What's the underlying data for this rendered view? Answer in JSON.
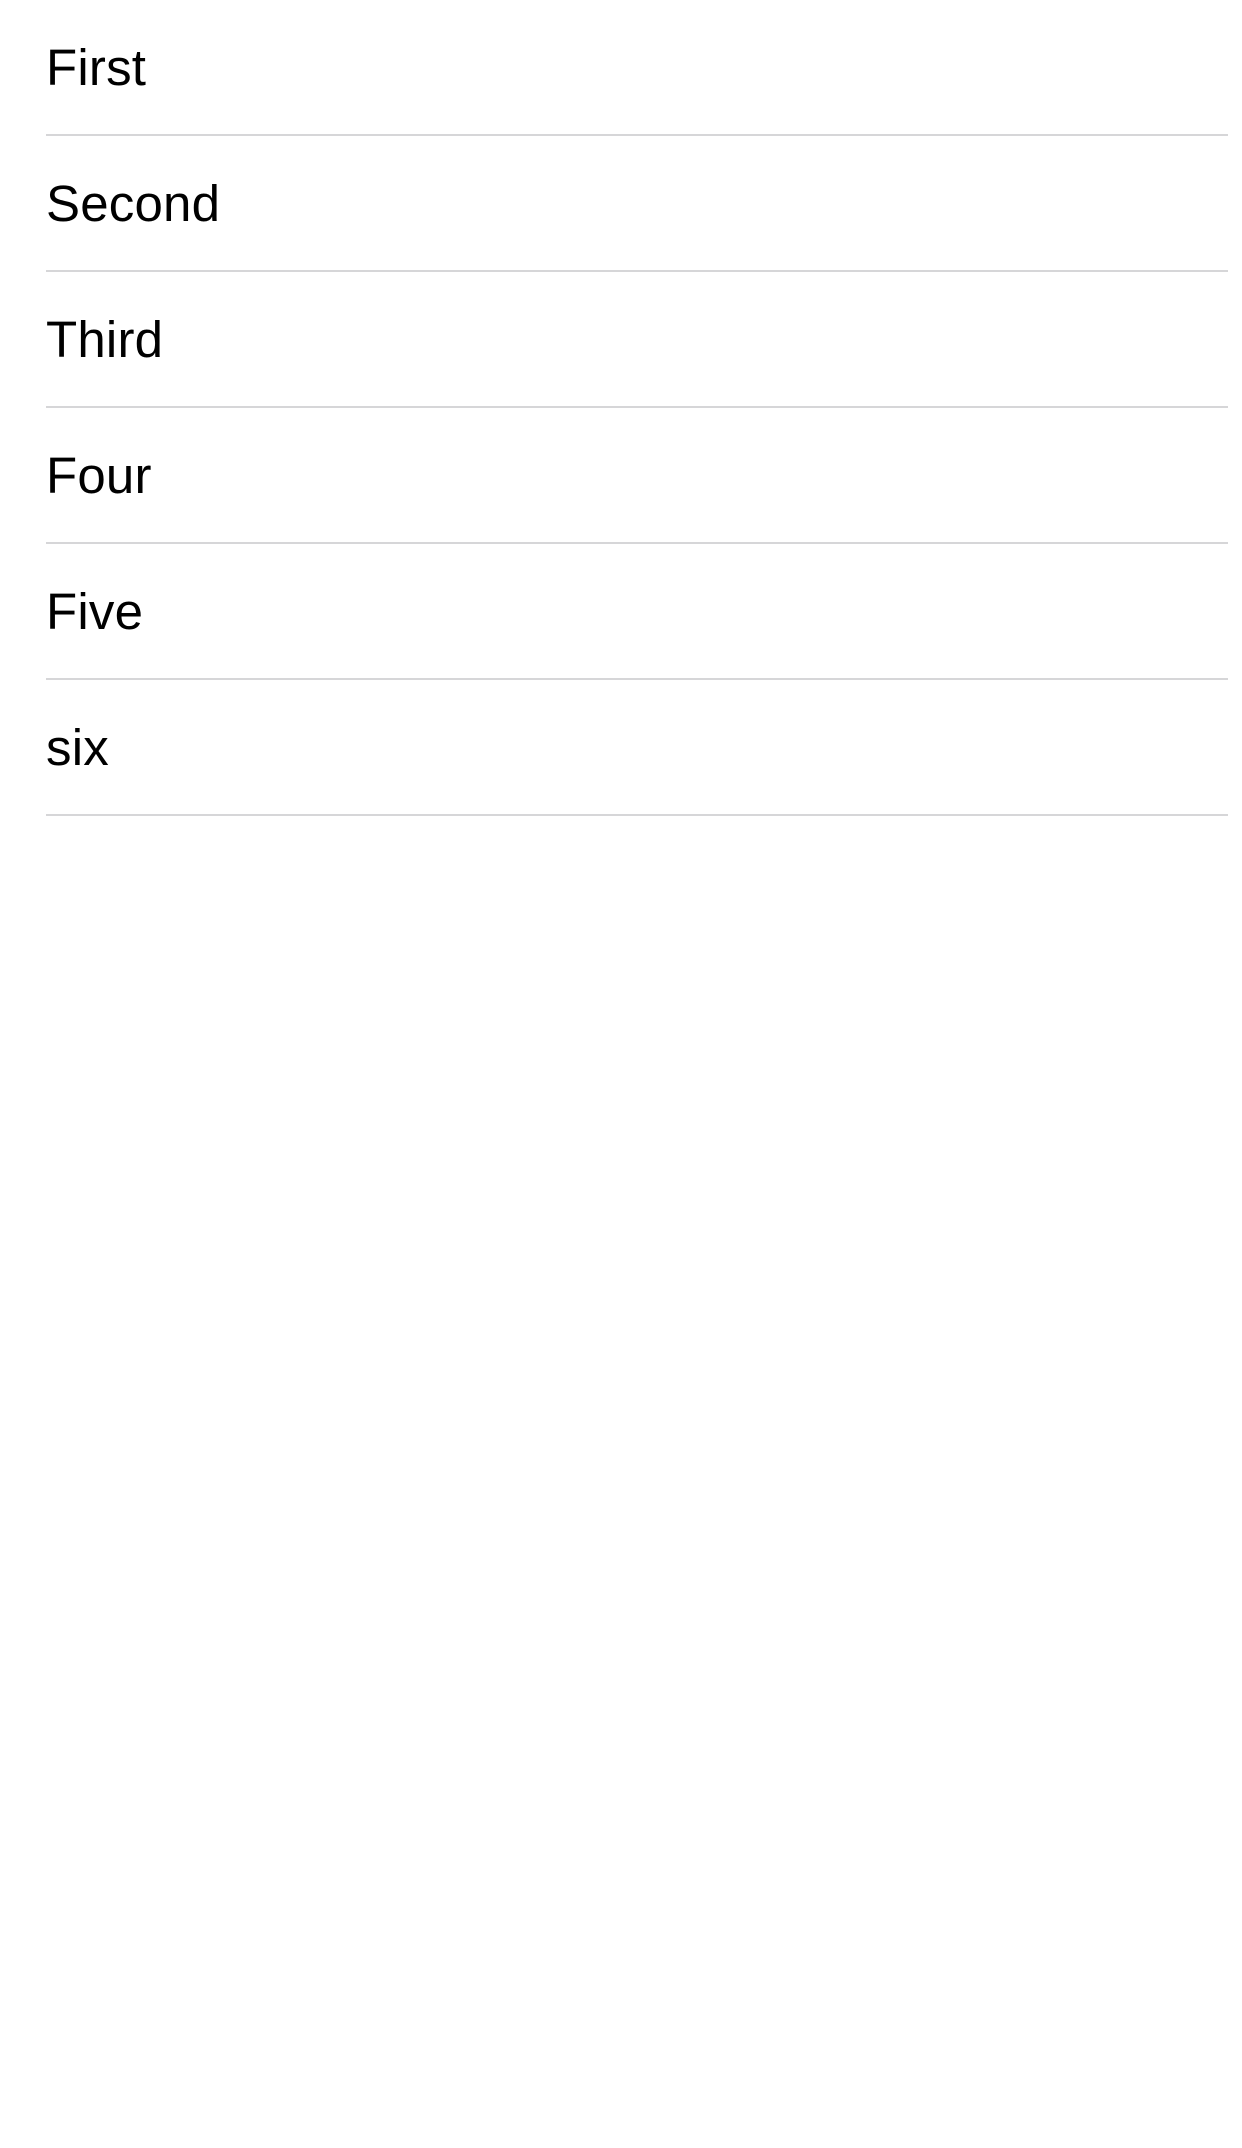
{
  "list": {
    "items": [
      {
        "label": "First"
      },
      {
        "label": "Second"
      },
      {
        "label": "Third"
      },
      {
        "label": "Four"
      },
      {
        "label": "Five"
      },
      {
        "label": "six"
      }
    ]
  },
  "colors": {
    "background": "#ffffff",
    "text": "#000000",
    "separator": "#d6d6d8"
  }
}
